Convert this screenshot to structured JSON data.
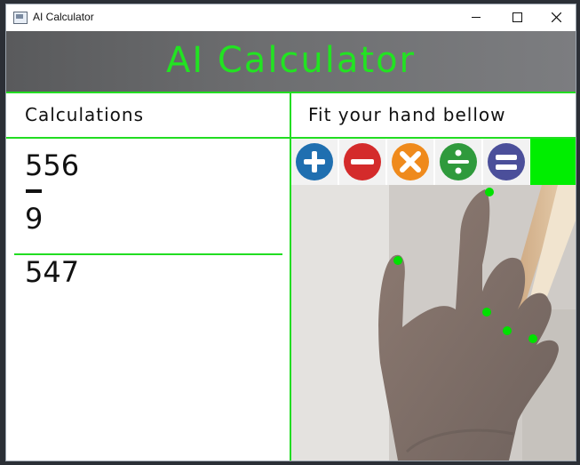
{
  "window": {
    "title": "AI Calculator"
  },
  "header": {
    "title": "AI Calculator",
    "color": "#22e322"
  },
  "left_panel": {
    "label": "Calculations",
    "operand1": "556",
    "operator": "minus",
    "operand2": "9",
    "result": "547"
  },
  "right_panel": {
    "label": "Fit your hand bellow",
    "operations": [
      {
        "name": "plus",
        "color": "#1f6fb0"
      },
      {
        "name": "minus",
        "color": "#d42b2b"
      },
      {
        "name": "multiply",
        "color": "#ef8a1c"
      },
      {
        "name": "divide",
        "color": "#2f9a3c"
      },
      {
        "name": "equals",
        "color": "#4b4f9a"
      }
    ]
  },
  "colors": {
    "accent": "#22dd22",
    "landmark": "#00e000"
  }
}
